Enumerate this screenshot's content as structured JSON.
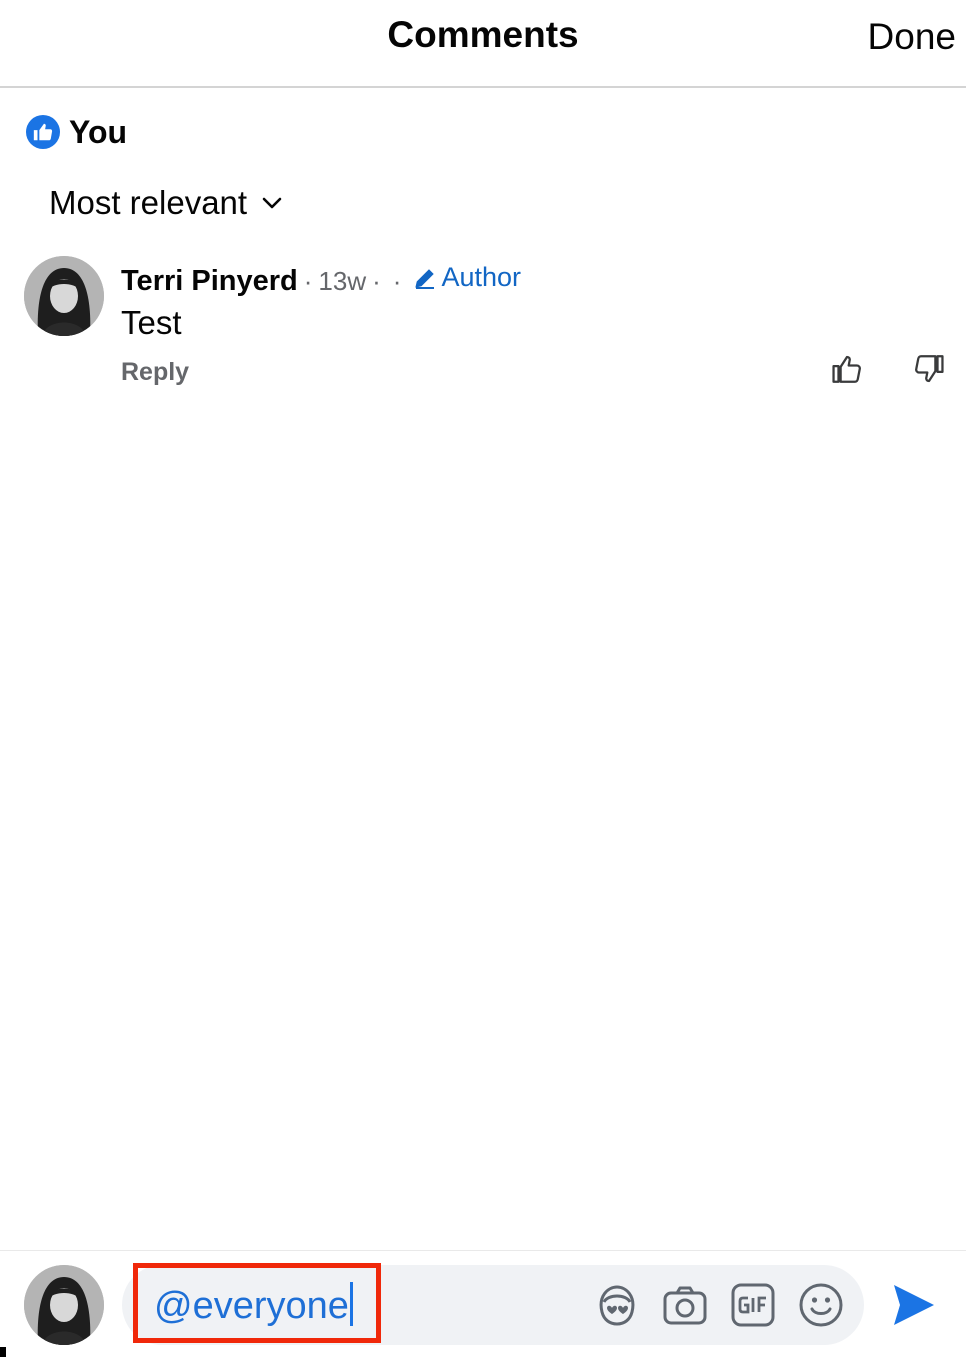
{
  "header": {
    "title": "Comments",
    "done_label": "Done"
  },
  "reactions": {
    "name": "You",
    "icon": "like-badge-icon",
    "badge_color": "#1b74e4"
  },
  "sort": {
    "label": "Most relevant"
  },
  "comment": {
    "author": "Terri Pinyerd",
    "separator": "·",
    "time": "13w",
    "badge_label": "Author",
    "text": "Test",
    "reply_label": "Reply"
  },
  "composer": {
    "value": "@everyone",
    "tools": [
      "avatar-sticker-icon",
      "camera-icon",
      "gif-icon",
      "emoji-icon"
    ],
    "accent_color": "#1b74e4",
    "highlight_color": "#f0280a"
  }
}
